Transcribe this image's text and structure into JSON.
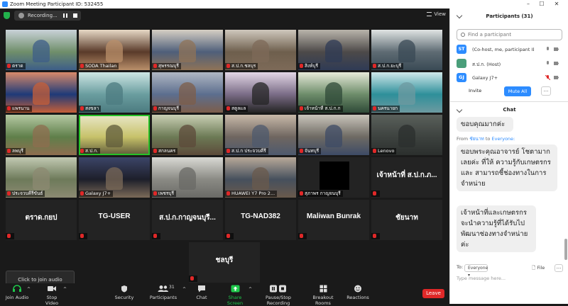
{
  "window": {
    "title": "Zoom Meeting Participant ID: 532455",
    "controls": [
      "–",
      "☐",
      "✕"
    ]
  },
  "topbar": {
    "recording_label": "Recording...",
    "view_label": "View"
  },
  "tiles": [
    {
      "name": "ตราด",
      "kind": "video",
      "colors": [
        "#6f8e6a",
        "#c9d2d8",
        "#3d5e88"
      ]
    },
    {
      "name": "SODA Thailan",
      "kind": "video",
      "colors": [
        "#5a3b2a",
        "#e7d9c6",
        "#b98f6a"
      ]
    },
    {
      "name": "สุพรรณบุรี",
      "kind": "video",
      "colors": [
        "#4f5f7a",
        "#d6cfc4",
        "#8f7357"
      ]
    },
    {
      "name": "ส.ป.ก.ชลบุร",
      "kind": "video",
      "colors": [
        "#6e5f4d",
        "#cfc8bd",
        "#7d6a58"
      ]
    },
    {
      "name": "สิงห์บุรี",
      "kind": "video",
      "colors": [
        "#4d4a49",
        "#b9b4ab",
        "#2f3b55"
      ]
    },
    {
      "name": "ส.ป.ก.ยะบุรี",
      "kind": "video",
      "colors": [
        "#5e6b73",
        "#e0e4e3",
        "#3a4a55"
      ]
    },
    {
      "name": "แพรนาน",
      "kind": "video",
      "colors": [
        "#1e3a78",
        "#d98a6a",
        "#c75f38"
      ]
    },
    {
      "name": "สงขลา",
      "kind": "video",
      "colors": [
        "#6a9d9f",
        "#cde6e4",
        "#4c7b80"
      ]
    },
    {
      "name": "กาญจนบุรี",
      "kind": "video",
      "colors": [
        "#5c6e8e",
        "#b0b7c3",
        "#7d5e4a"
      ]
    },
    {
      "name": "สตูลแล",
      "kind": "video",
      "colors": [
        "#7a6c86",
        "#e3d7e6",
        "#242424"
      ]
    },
    {
      "name": "เจ้าหน้าที่ ส.ป.ก.ก",
      "kind": "video",
      "colors": [
        "#6d8c6a",
        "#e7ead9",
        "#2f4a38"
      ]
    },
    {
      "name": "นครนายก",
      "kind": "video",
      "colors": [
        "#2e8f9a",
        "#d0e8ea",
        "#6d9aa0"
      ]
    },
    {
      "name": "ลพบุรี",
      "kind": "video",
      "colors": [
        "#5f7f4a",
        "#b5c9a3",
        "#8e6d4f"
      ]
    },
    {
      "name": "ส.ป.ก.",
      "kind": "video",
      "colors": [
        "#c7c26a",
        "#e9e7c9",
        "#5e5a3a"
      ],
      "highlight": true
    },
    {
      "name": "สกลนคร",
      "kind": "video",
      "colors": [
        "#6c7a55",
        "#c9cfb4",
        "#5c4a3a"
      ]
    },
    {
      "name": "ส.ป.ก ประจวบคีรี",
      "kind": "video",
      "colors": [
        "#6f6660",
        "#c8b9a9",
        "#4e5a6e"
      ]
    },
    {
      "name": "จันทบุรี",
      "kind": "video",
      "colors": [
        "#6e6a63",
        "#c9c4bb",
        "#3d4b66"
      ]
    },
    {
      "name": "Lenovo",
      "kind": "video",
      "colors": [
        "#3d423f",
        "#5a605b",
        "#2b2f2d"
      ]
    },
    {
      "name": "ประจวบคีรีขันธ์",
      "kind": "video",
      "colors": [
        "#6d7a5a",
        "#c2c9b2",
        "#8c8a72"
      ]
    },
    {
      "name": "Galaxy J7+",
      "kind": "video",
      "colors": [
        "#1d1f2a",
        "#3c4568",
        "#7b6a58"
      ]
    },
    {
      "name": "เพชรบุรี",
      "kind": "video",
      "colors": [
        "#8a8a84",
        "#d9d9d4",
        "#6a6a66"
      ]
    },
    {
      "name": "HUAWEI Y7 Pro 2...",
      "kind": "video",
      "colors": [
        "#46505d",
        "#b8a999",
        "#6a5a4c"
      ]
    },
    {
      "name": "สุภาพร กาญจนบุรี",
      "kind": "black"
    },
    {
      "name": "",
      "kind": "text",
      "text": "เจ้าหน้าที่ ส.ป.ก.ภ..."
    },
    {
      "name": "",
      "kind": "text",
      "text": "ตราด.กยป"
    },
    {
      "name": "",
      "kind": "text",
      "text": "TG-USER"
    },
    {
      "name": "",
      "kind": "text",
      "text": "ส.ป.ก.กาญจนบุรี..."
    },
    {
      "name": "",
      "kind": "text",
      "text": "TG-NAD382"
    },
    {
      "name": "",
      "kind": "text",
      "text": "Maliwan Bunrak"
    },
    {
      "name": "",
      "kind": "text",
      "text": "ชัยนาท"
    },
    {
      "name": "",
      "kind": "text",
      "text": "ชลบุรี"
    }
  ],
  "audio_tip": "Click to join audio",
  "toolbar": {
    "join_audio": "Join Audio",
    "stop_video": "Stop Video",
    "security": "Security",
    "participants": "Participants",
    "participants_count": "31",
    "chat": "Chat",
    "share_screen": "Share Screen",
    "record": "Pause/Stop Recording",
    "breakout": "Breakout Rooms",
    "reactions": "Reactions",
    "leave": "Leave"
  },
  "participants_panel": {
    "header": "Participants (31)",
    "search_placeholder": "Find a participant",
    "rows": [
      {
        "initials": "ST",
        "color": "#2d8cff",
        "name": "(Co-host, me, participant ID: 532455)"
      },
      {
        "initials": "",
        "color": "#4a9e7a",
        "name": "ส.ป.ก. (Host)"
      },
      {
        "initials": "GJ",
        "color": "#2d8cff",
        "name": "Galaxy J7+"
      }
    ],
    "invite": "Invite",
    "mute_all": "Mute All",
    "more": "..."
  },
  "chat_panel": {
    "header": "Chat",
    "messages": [
      {
        "text": "ขอบคุณมากค่ะ"
      },
      {
        "from_prefix": "From",
        "sender": "ชัยนาท",
        "to": "to",
        "recipient": "Everyone:"
      },
      {
        "text": "ขอบพระคุณอาจารย์ โชตามากเลยค่ะ ที่ให้ ความรู้กับเกษตรกร และ สามารถชี้ช่องทางในการ จำหน่าย"
      },
      {
        "text": "เจ้าหน้าที่และเกษตรกร จะนำความรู้ที่ได้รับไป พัฒนาช่องทางจำหน่าย ค่ะ"
      }
    ],
    "to_label": "To:",
    "to_value": "Everyone",
    "file_label": "File",
    "more": "...",
    "input_placeholder": "Type message here..."
  }
}
